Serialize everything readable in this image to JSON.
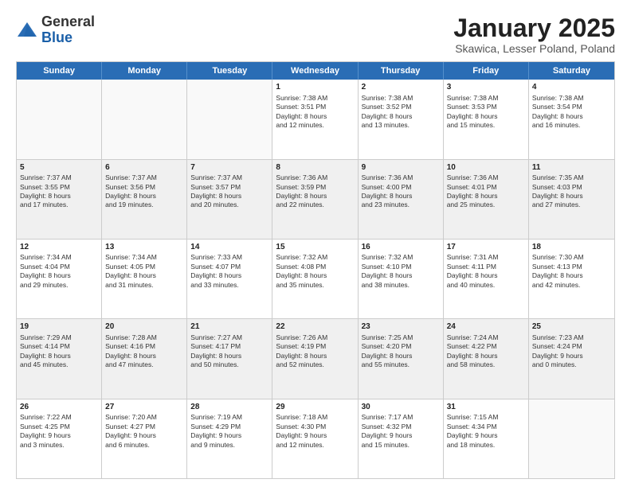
{
  "header": {
    "logo_general": "General",
    "logo_blue": "Blue",
    "title": "January 2025",
    "subtitle": "Skawica, Lesser Poland, Poland"
  },
  "weekdays": [
    "Sunday",
    "Monday",
    "Tuesday",
    "Wednesday",
    "Thursday",
    "Friday",
    "Saturday"
  ],
  "weeks": [
    [
      {
        "day": "",
        "info": ""
      },
      {
        "day": "",
        "info": ""
      },
      {
        "day": "",
        "info": ""
      },
      {
        "day": "1",
        "info": "Sunrise: 7:38 AM\nSunset: 3:51 PM\nDaylight: 8 hours\nand 12 minutes."
      },
      {
        "day": "2",
        "info": "Sunrise: 7:38 AM\nSunset: 3:52 PM\nDaylight: 8 hours\nand 13 minutes."
      },
      {
        "day": "3",
        "info": "Sunrise: 7:38 AM\nSunset: 3:53 PM\nDaylight: 8 hours\nand 15 minutes."
      },
      {
        "day": "4",
        "info": "Sunrise: 7:38 AM\nSunset: 3:54 PM\nDaylight: 8 hours\nand 16 minutes."
      }
    ],
    [
      {
        "day": "5",
        "info": "Sunrise: 7:37 AM\nSunset: 3:55 PM\nDaylight: 8 hours\nand 17 minutes."
      },
      {
        "day": "6",
        "info": "Sunrise: 7:37 AM\nSunset: 3:56 PM\nDaylight: 8 hours\nand 19 minutes."
      },
      {
        "day": "7",
        "info": "Sunrise: 7:37 AM\nSunset: 3:57 PM\nDaylight: 8 hours\nand 20 minutes."
      },
      {
        "day": "8",
        "info": "Sunrise: 7:36 AM\nSunset: 3:59 PM\nDaylight: 8 hours\nand 22 minutes."
      },
      {
        "day": "9",
        "info": "Sunrise: 7:36 AM\nSunset: 4:00 PM\nDaylight: 8 hours\nand 23 minutes."
      },
      {
        "day": "10",
        "info": "Sunrise: 7:36 AM\nSunset: 4:01 PM\nDaylight: 8 hours\nand 25 minutes."
      },
      {
        "day": "11",
        "info": "Sunrise: 7:35 AM\nSunset: 4:03 PM\nDaylight: 8 hours\nand 27 minutes."
      }
    ],
    [
      {
        "day": "12",
        "info": "Sunrise: 7:34 AM\nSunset: 4:04 PM\nDaylight: 8 hours\nand 29 minutes."
      },
      {
        "day": "13",
        "info": "Sunrise: 7:34 AM\nSunset: 4:05 PM\nDaylight: 8 hours\nand 31 minutes."
      },
      {
        "day": "14",
        "info": "Sunrise: 7:33 AM\nSunset: 4:07 PM\nDaylight: 8 hours\nand 33 minutes."
      },
      {
        "day": "15",
        "info": "Sunrise: 7:32 AM\nSunset: 4:08 PM\nDaylight: 8 hours\nand 35 minutes."
      },
      {
        "day": "16",
        "info": "Sunrise: 7:32 AM\nSunset: 4:10 PM\nDaylight: 8 hours\nand 38 minutes."
      },
      {
        "day": "17",
        "info": "Sunrise: 7:31 AM\nSunset: 4:11 PM\nDaylight: 8 hours\nand 40 minutes."
      },
      {
        "day": "18",
        "info": "Sunrise: 7:30 AM\nSunset: 4:13 PM\nDaylight: 8 hours\nand 42 minutes."
      }
    ],
    [
      {
        "day": "19",
        "info": "Sunrise: 7:29 AM\nSunset: 4:14 PM\nDaylight: 8 hours\nand 45 minutes."
      },
      {
        "day": "20",
        "info": "Sunrise: 7:28 AM\nSunset: 4:16 PM\nDaylight: 8 hours\nand 47 minutes."
      },
      {
        "day": "21",
        "info": "Sunrise: 7:27 AM\nSunset: 4:17 PM\nDaylight: 8 hours\nand 50 minutes."
      },
      {
        "day": "22",
        "info": "Sunrise: 7:26 AM\nSunset: 4:19 PM\nDaylight: 8 hours\nand 52 minutes."
      },
      {
        "day": "23",
        "info": "Sunrise: 7:25 AM\nSunset: 4:20 PM\nDaylight: 8 hours\nand 55 minutes."
      },
      {
        "day": "24",
        "info": "Sunrise: 7:24 AM\nSunset: 4:22 PM\nDaylight: 8 hours\nand 58 minutes."
      },
      {
        "day": "25",
        "info": "Sunrise: 7:23 AM\nSunset: 4:24 PM\nDaylight: 9 hours\nand 0 minutes."
      }
    ],
    [
      {
        "day": "26",
        "info": "Sunrise: 7:22 AM\nSunset: 4:25 PM\nDaylight: 9 hours\nand 3 minutes."
      },
      {
        "day": "27",
        "info": "Sunrise: 7:20 AM\nSunset: 4:27 PM\nDaylight: 9 hours\nand 6 minutes."
      },
      {
        "day": "28",
        "info": "Sunrise: 7:19 AM\nSunset: 4:29 PM\nDaylight: 9 hours\nand 9 minutes."
      },
      {
        "day": "29",
        "info": "Sunrise: 7:18 AM\nSunset: 4:30 PM\nDaylight: 9 hours\nand 12 minutes."
      },
      {
        "day": "30",
        "info": "Sunrise: 7:17 AM\nSunset: 4:32 PM\nDaylight: 9 hours\nand 15 minutes."
      },
      {
        "day": "31",
        "info": "Sunrise: 7:15 AM\nSunset: 4:34 PM\nDaylight: 9 hours\nand 18 minutes."
      },
      {
        "day": "",
        "info": ""
      }
    ]
  ]
}
